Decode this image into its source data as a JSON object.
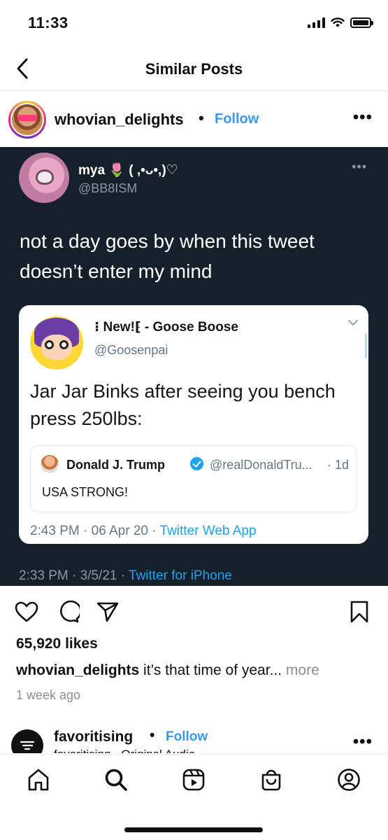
{
  "status_bar": {
    "time": "11:33"
  },
  "nav": {
    "title": "Similar Posts"
  },
  "post": {
    "username": "whovian_delights",
    "separator": "•",
    "follow_label": "Follow",
    "more": "•••"
  },
  "tweet": {
    "display_name": "mya 🌷 ( ,•ᴗ•,)♡",
    "handle": "@BB8ISM",
    "more": "•••",
    "text": "not a day goes by when this tweet doesn’t enter my mind",
    "meta_time": "2:33 PM · 3/5/21 · ",
    "meta_source": "Twitter for iPhone",
    "quoted": {
      "display_name": "⁝ New!⁅ - Goose Boose",
      "handle": "@Goosenpai",
      "text": "Jar Jar Binks after seeing you bench press 250lbs:",
      "meta_time": "2:43 PM · 06 Apr 20 · ",
      "meta_source": "Twitter Web App",
      "inner": {
        "name": "Donald J. Trump",
        "handle": "@realDonaldTru...",
        "time": "· 1d",
        "text": "USA STRONG!"
      }
    }
  },
  "engagement": {
    "likes": "65,920 likes",
    "caption_user": "whovian_delights",
    "caption_text": " it’s that time of year... ",
    "caption_more": "more",
    "time_ago": "1 week ago"
  },
  "next_post": {
    "username": "favoritising",
    "separator": "•",
    "follow_label": "Follow",
    "subtitle": "favoritising · Original Audio",
    "more": "•••"
  },
  "icons": {
    "action_bar": [
      "heart-icon",
      "comment-icon",
      "share-icon",
      "bookmark-icon"
    ],
    "tab_bar": [
      "home-icon",
      "search-icon",
      "reels-icon",
      "shop-icon",
      "profile-icon"
    ]
  },
  "colors": {
    "accent": "#3897f0",
    "tweet_background": "#15202b",
    "twitter_blue": "#1da1f2",
    "secondary_text": "#8e8e8e"
  }
}
